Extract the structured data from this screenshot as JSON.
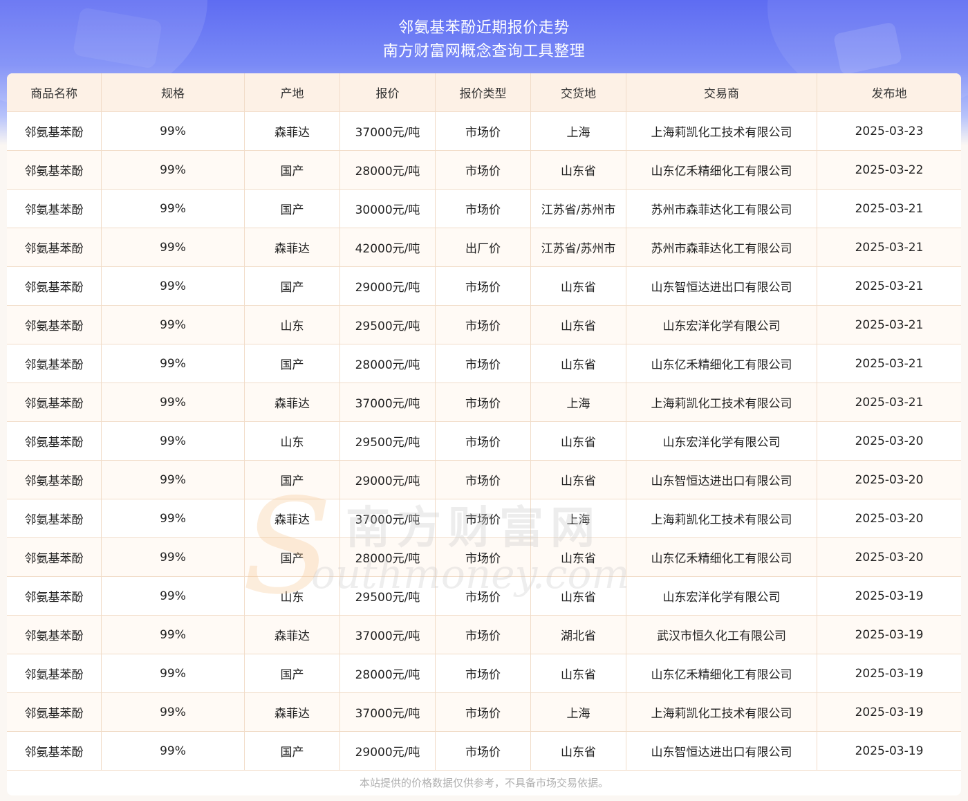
{
  "header": {
    "title_line1": "邻氨基苯酚近期报价走势",
    "title_line2": "南方财富网概念查询工具整理"
  },
  "table": {
    "columns": [
      "商品名称",
      "规格",
      "产地",
      "报价",
      "报价类型",
      "交货地",
      "交易商",
      "发布地"
    ],
    "rows": [
      [
        "邻氨基苯酚",
        "99%",
        "森菲达",
        "37000元/吨",
        "市场价",
        "上海",
        "上海莉凯化工技术有限公司",
        "2025-03-23"
      ],
      [
        "邻氨基苯酚",
        "99%",
        "国产",
        "28000元/吨",
        "市场价",
        "山东省",
        "山东亿禾精细化工有限公司",
        "2025-03-22"
      ],
      [
        "邻氨基苯酚",
        "99%",
        "国产",
        "30000元/吨",
        "市场价",
        "江苏省/苏州市",
        "苏州市森菲达化工有限公司",
        "2025-03-21"
      ],
      [
        "邻氨基苯酚",
        "99%",
        "森菲达",
        "42000元/吨",
        "出厂价",
        "江苏省/苏州市",
        "苏州市森菲达化工有限公司",
        "2025-03-21"
      ],
      [
        "邻氨基苯酚",
        "99%",
        "国产",
        "29000元/吨",
        "市场价",
        "山东省",
        "山东智恒达进出口有限公司",
        "2025-03-21"
      ],
      [
        "邻氨基苯酚",
        "99%",
        "山东",
        "29500元/吨",
        "市场价",
        "山东省",
        "山东宏洋化学有限公司",
        "2025-03-21"
      ],
      [
        "邻氨基苯酚",
        "99%",
        "国产",
        "28000元/吨",
        "市场价",
        "山东省",
        "山东亿禾精细化工有限公司",
        "2025-03-21"
      ],
      [
        "邻氨基苯酚",
        "99%",
        "森菲达",
        "37000元/吨",
        "市场价",
        "上海",
        "上海莉凯化工技术有限公司",
        "2025-03-21"
      ],
      [
        "邻氨基苯酚",
        "99%",
        "山东",
        "29500元/吨",
        "市场价",
        "山东省",
        "山东宏洋化学有限公司",
        "2025-03-20"
      ],
      [
        "邻氨基苯酚",
        "99%",
        "国产",
        "29000元/吨",
        "市场价",
        "山东省",
        "山东智恒达进出口有限公司",
        "2025-03-20"
      ],
      [
        "邻氨基苯酚",
        "99%",
        "森菲达",
        "37000元/吨",
        "市场价",
        "上海",
        "上海莉凯化工技术有限公司",
        "2025-03-20"
      ],
      [
        "邻氨基苯酚",
        "99%",
        "国产",
        "28000元/吨",
        "市场价",
        "山东省",
        "山东亿禾精细化工有限公司",
        "2025-03-20"
      ],
      [
        "邻氨基苯酚",
        "99%",
        "山东",
        "29500元/吨",
        "市场价",
        "山东省",
        "山东宏洋化学有限公司",
        "2025-03-19"
      ],
      [
        "邻氨基苯酚",
        "99%",
        "森菲达",
        "37000元/吨",
        "市场价",
        "湖北省",
        "武汉市恒久化工有限公司",
        "2025-03-19"
      ],
      [
        "邻氨基苯酚",
        "99%",
        "国产",
        "28000元/吨",
        "市场价",
        "山东省",
        "山东亿禾精细化工有限公司",
        "2025-03-19"
      ],
      [
        "邻氨基苯酚",
        "99%",
        "森菲达",
        "37000元/吨",
        "市场价",
        "上海",
        "上海莉凯化工技术有限公司",
        "2025-03-19"
      ],
      [
        "邻氨基苯酚",
        "99%",
        "国产",
        "29000元/吨",
        "市场价",
        "山东省",
        "山东智恒达进出口有限公司",
        "2025-03-19"
      ]
    ]
  },
  "footer": {
    "disclaimer": "本站提供的价格数据仅供参考，不具备市场交易依据。"
  },
  "watermark": {
    "cn": "南方财富网",
    "en": "outhmoney.com",
    "mark": "S"
  }
}
